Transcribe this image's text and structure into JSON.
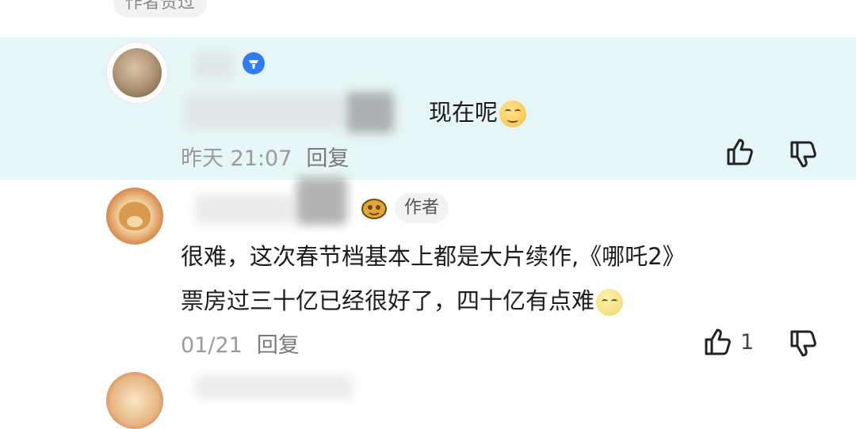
{
  "prev_comment": {
    "author_liked_tag": "作者赞过"
  },
  "reply": {
    "text": "现在呢",
    "emoji": "smiling-sunglasses-emoji",
    "time": "昨天 21:07",
    "reply_label": "回复"
  },
  "comment": {
    "author_tag": "作者",
    "line1": "很难，这次春节档基本上都是大片续作,《哪吒2》",
    "line2": "票房过三十亿已经很好了，四十亿有点难",
    "emoji": "moon-face-emoji",
    "time": "01/21",
    "reply_label": "回复",
    "like_count": "1"
  },
  "colors": {
    "highlight_bg": "#e6f5f5",
    "meta_text": "#9b9b9b",
    "verified_badge": "#2f7cf6"
  }
}
